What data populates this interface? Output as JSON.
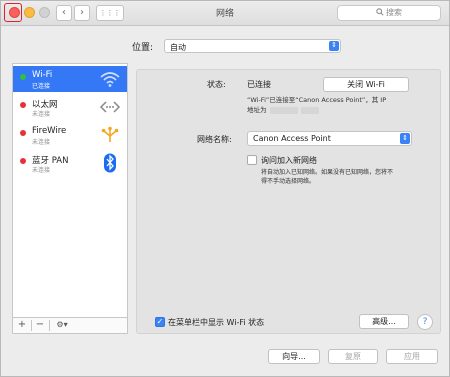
{
  "window": {
    "title": "网络"
  },
  "toolbar": {
    "back": "‹",
    "forward": "›",
    "grid": "⋮⋮⋮"
  },
  "search": {
    "placeholder": "搜索",
    "icon": "magnifier-icon"
  },
  "location": {
    "label": "位置:",
    "value": "自动"
  },
  "sidebar": {
    "items": [
      {
        "name": "Wi-Fi",
        "status": "已连接",
        "dot_color": "#2ec23a",
        "icon": "wifi-icon",
        "selected": true
      },
      {
        "name": "以太网",
        "status": "未连接",
        "dot_color": "#e8303a",
        "icon": "ethernet-icon",
        "selected": false
      },
      {
        "name": "FireWire",
        "status": "未连接",
        "dot_color": "#e8303a",
        "icon": "firewire-icon",
        "selected": false
      },
      {
        "name": "蓝牙 PAN",
        "status": "未连接",
        "dot_color": "#e8303a",
        "icon": "bluetooth-icon",
        "selected": false
      }
    ],
    "tools": {
      "add": "+",
      "remove": "−",
      "action": "⚙▾"
    }
  },
  "detail": {
    "status_label": "状态:",
    "status_value": "已连接",
    "toggle_wifi_button": "关闭 Wi-Fi",
    "status_desc_line1": "“Wi-Fi”已连接至“Canon Access Point”，其 IP",
    "status_desc_line2_prefix": "地址为",
    "network_name_label": "网络名称:",
    "network_name_value": "Canon Access Point",
    "ask_join_label": "询问加入新网络",
    "ask_join_checked": false,
    "ask_join_desc_line1": "将自动加入已知网络。如果没有已知网络，您将不",
    "ask_join_desc_line2": "得不手动选择网络。",
    "show_menubar_label": "在菜单栏中显示 Wi-Fi 状态",
    "show_menubar_checked": true,
    "advanced_button": "高级...",
    "help": "?"
  },
  "footer": {
    "assist_button": "向导...",
    "revert_button": "复原",
    "apply_button": "应用"
  },
  "colors": {
    "accent": "#3b82f7",
    "selection": "#3478f6",
    "close_highlight": "#e0202a"
  }
}
